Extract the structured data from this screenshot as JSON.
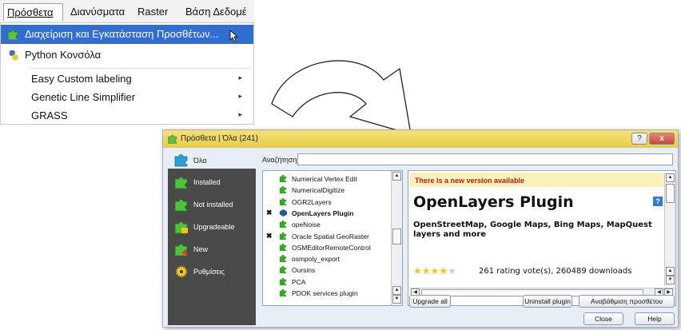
{
  "menubar": {
    "items": [
      "Πρόσθετα",
      "Διανύσματα",
      "Raster",
      "Βάση Δεδομέ"
    ]
  },
  "dropdown": {
    "items": [
      {
        "label": "Διαχείριση και Εγκατάσταση Προσθέτων...",
        "icon": "puzzle-icon",
        "submenu": false,
        "highlighted": true
      },
      {
        "label": "Python Κονσόλα",
        "icon": "python-icon",
        "submenu": false,
        "highlighted": false
      },
      {
        "label": "Easy Custom labeling",
        "icon": "",
        "submenu": true,
        "highlighted": false
      },
      {
        "label": "Genetic Line Simplifier",
        "icon": "",
        "submenu": true,
        "highlighted": false
      },
      {
        "label": "GRASS",
        "icon": "",
        "submenu": true,
        "highlighted": false
      }
    ],
    "submenu_arrow": "▸"
  },
  "dialog": {
    "title": "Πρόσθετα | Όλα (241)",
    "titlebar_help": "?",
    "titlebar_close": "x",
    "categories": [
      {
        "label": "Όλα",
        "icon": "puzzle-icon"
      },
      {
        "label": "Installed",
        "icon": "puzzle-icon"
      },
      {
        "label": "Not installed",
        "icon": "puzzle-icon"
      },
      {
        "label": "Upgradeable",
        "icon": "puzzle-upgrade-icon"
      },
      {
        "label": "New",
        "icon": "puzzle-new-icon"
      },
      {
        "label": "Ρυθμίσεις",
        "icon": "gear-icon"
      }
    ],
    "search_label": "Αναζήτηση",
    "search_value": "",
    "plugins": [
      {
        "name": "Numerical Vertex Edit",
        "mark": "",
        "selected": false
      },
      {
        "name": "NumericalDigitize",
        "mark": "",
        "selected": false
      },
      {
        "name": "OGR2Layers",
        "mark": "",
        "selected": false
      },
      {
        "name": "OpenLayers Plugin",
        "mark": "✖",
        "selected": true
      },
      {
        "name": "opeNoise",
        "mark": "",
        "selected": false
      },
      {
        "name": "Oracle Spatial GeoRaster",
        "mark": "✖",
        "selected": false
      },
      {
        "name": "OSMEditorRemoteControl",
        "mark": "",
        "selected": false
      },
      {
        "name": "osmpoly_export",
        "mark": "",
        "selected": false
      },
      {
        "name": "Oursins",
        "mark": "",
        "selected": false
      },
      {
        "name": "PCA",
        "mark": "",
        "selected": false
      },
      {
        "name": "PDOK services plugin",
        "mark": "",
        "selected": false
      }
    ],
    "detail": {
      "notice": "There is a new version available",
      "title": "OpenLayers Plugin",
      "help_icon": "?",
      "description": "OpenStreetMap, Google Maps, Bing Maps, MapQuest layers and more",
      "rating_stars": 4,
      "rating_max": 5,
      "rating_text": "261 rating vote(s), 260489 downloads"
    },
    "buttons": {
      "upgrade_all": "Upgrade all",
      "uninstall": "Uninstall plugin",
      "upgrade": "Αναβάθμιση προσθέτου",
      "close": "Close",
      "help": "Help"
    }
  },
  "colors": {
    "menu_highlight": "#2f6fd3",
    "titlebar": "#e9cc45",
    "notice_text": "#c01818",
    "notice_bg": "#f8f2b8",
    "sidebar": "#4a4a4a",
    "plugin_green": "#3aa52a"
  }
}
